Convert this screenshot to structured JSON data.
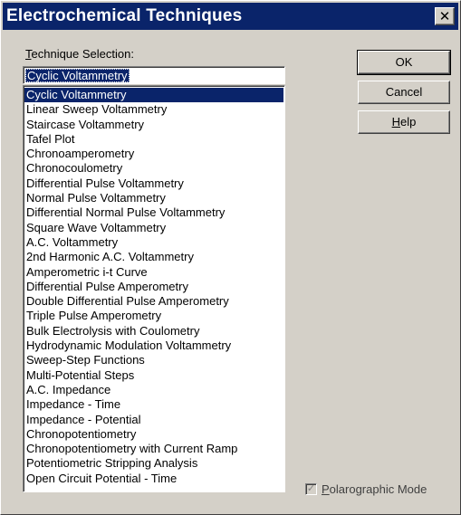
{
  "window": {
    "title": "Electrochemical Techniques",
    "close_glyph": "✕"
  },
  "technique_selection": {
    "label_mnemonic": "T",
    "label_rest": "echnique Selection:",
    "current_value": "Cyclic Voltammetry",
    "selected_index": 0,
    "items": [
      "Cyclic Voltammetry",
      "Linear Sweep Voltammetry",
      "Staircase Voltammetry",
      "Tafel Plot",
      "Chronoamperometry",
      "Chronocoulometry",
      "Differential Pulse Voltammetry",
      "Normal Pulse Voltammetry",
      "Differential Normal Pulse Voltammetry",
      "Square Wave Voltammetry",
      "A.C. Voltammetry",
      "2nd Harmonic A.C. Voltammetry",
      "Amperometric i-t Curve",
      "Differential Pulse Amperometry",
      "Double Differential Pulse Amperometry",
      "Triple Pulse Amperometry",
      "Bulk Electrolysis with Coulometry",
      "Hydrodynamic Modulation Voltammetry",
      "Sweep-Step Functions",
      "Multi-Potential Steps",
      "A.C. Impedance",
      "Impedance - Time",
      "Impedance - Potential",
      "Chronopotentiometry",
      "Chronopotentiometry with Current Ramp",
      "Potentiometric Stripping Analysis",
      "Open Circuit Potential - Time"
    ]
  },
  "buttons": {
    "ok": "OK",
    "cancel": "Cancel",
    "help_mnemonic": "H",
    "help_rest": "elp"
  },
  "polarographic_mode": {
    "checked": true,
    "enabled": false,
    "check_glyph": "✓",
    "label_mnemonic": "P",
    "label_rest": "olarographic Mode"
  }
}
